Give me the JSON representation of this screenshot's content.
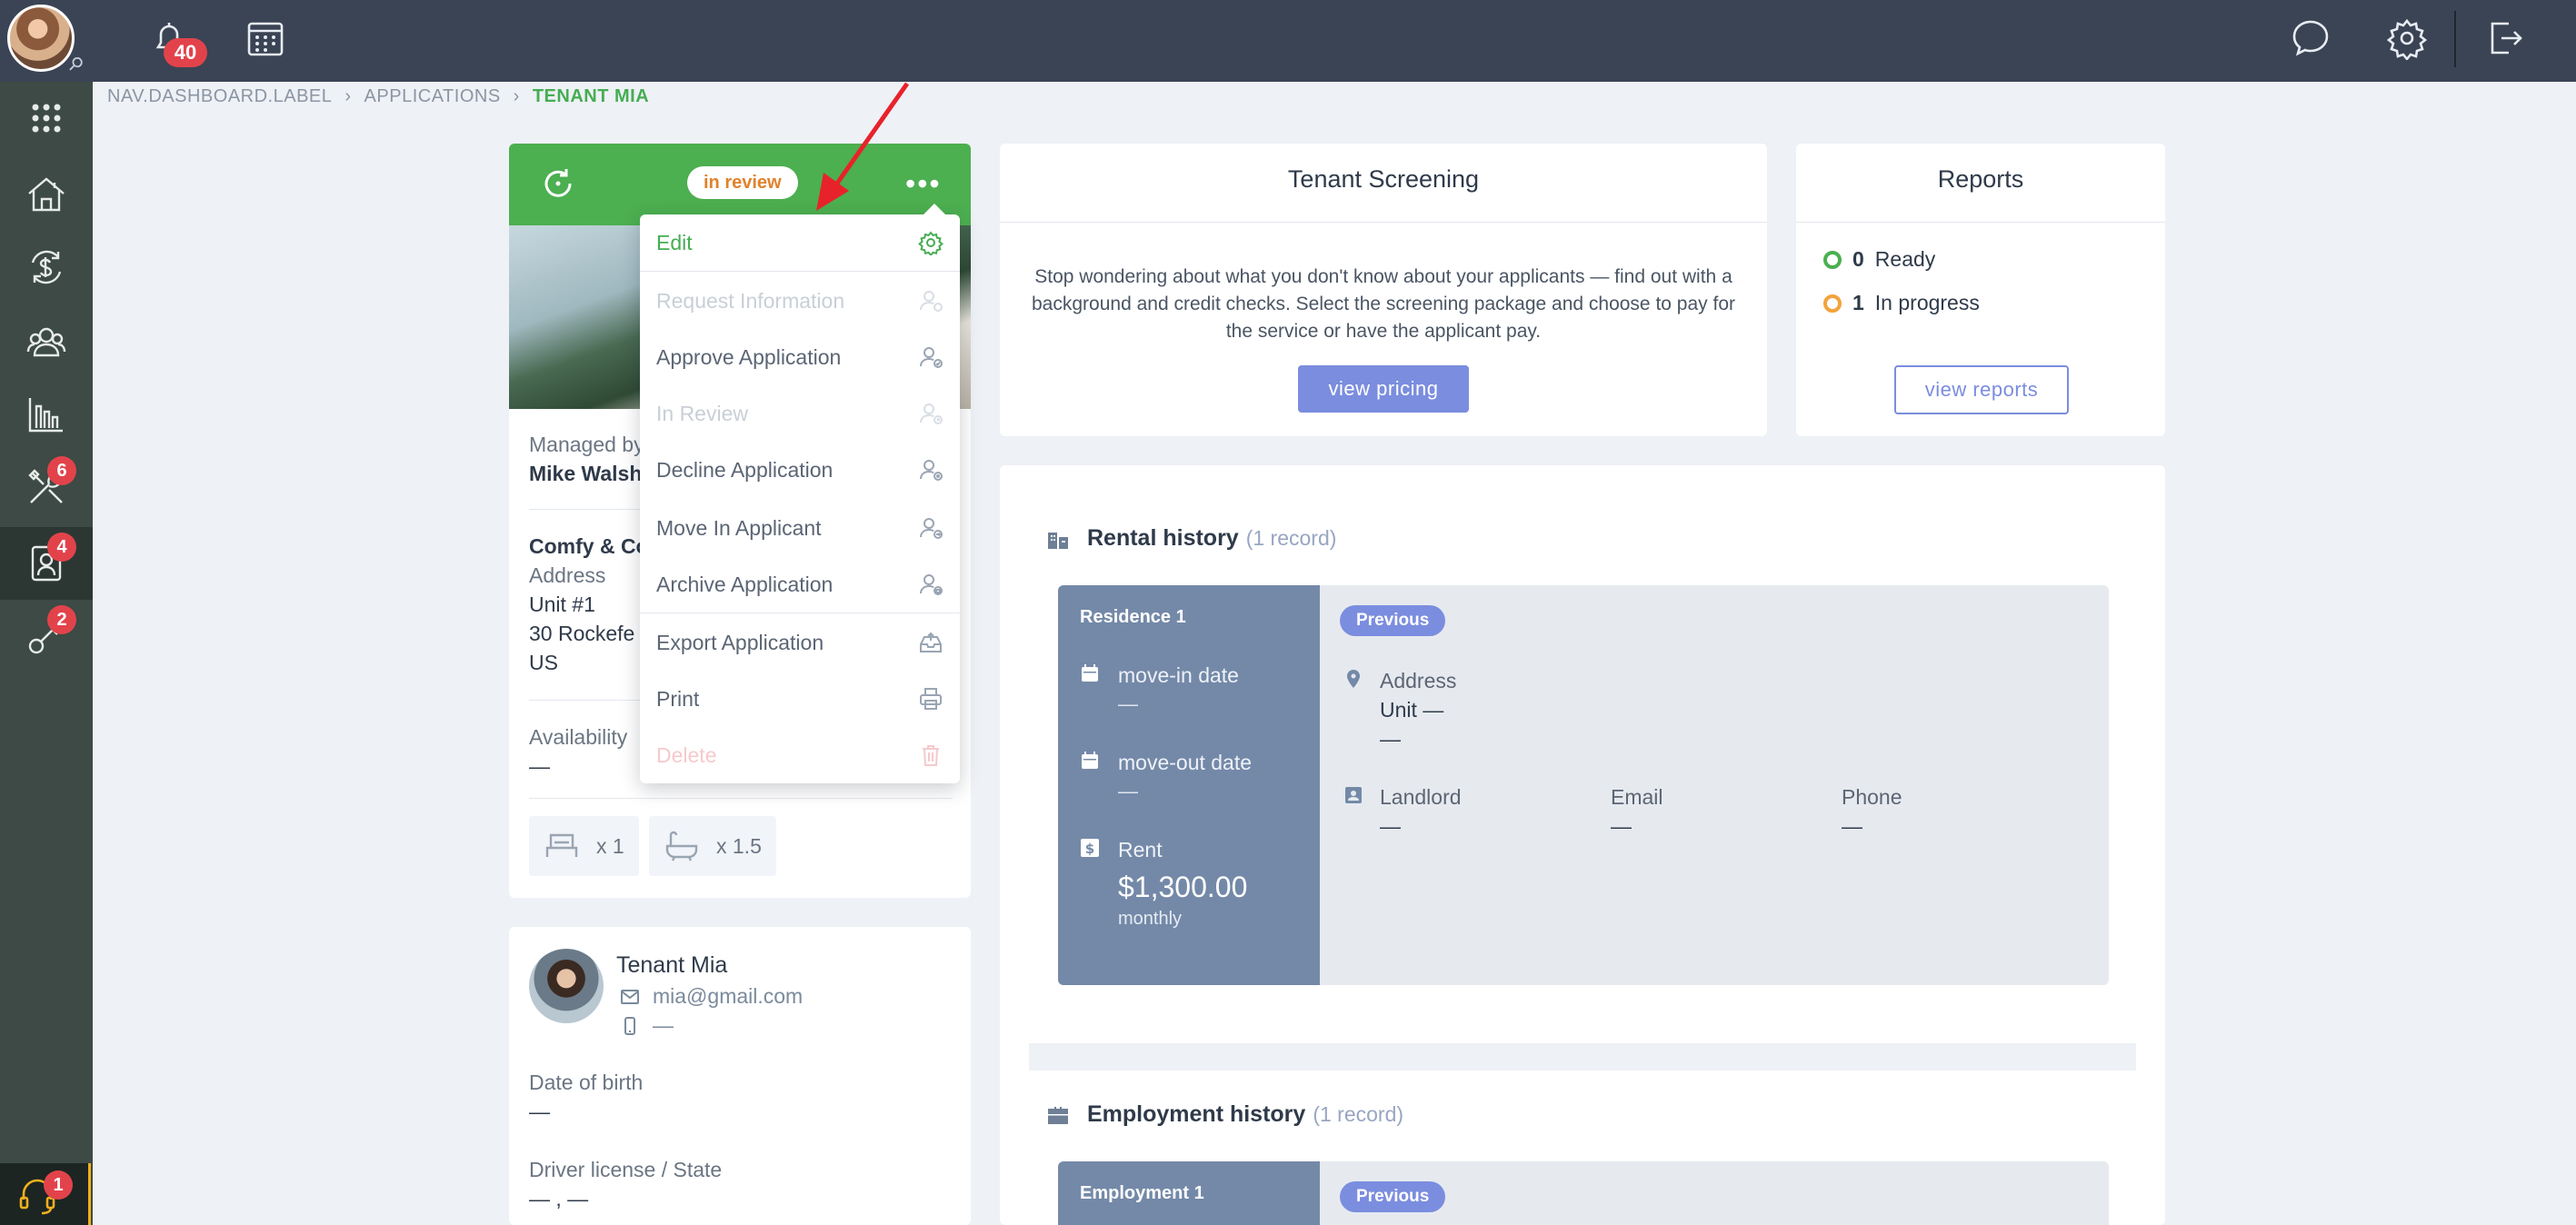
{
  "topbar": {
    "notification_count": "40"
  },
  "sidebar": {
    "items": [
      {
        "icon": "apps-grid-icon"
      },
      {
        "icon": "properties-icon"
      },
      {
        "icon": "accounting-icon"
      },
      {
        "icon": "people-icon"
      },
      {
        "icon": "reports-chart-icon"
      },
      {
        "icon": "maintenance-tools-icon",
        "badge": "6"
      },
      {
        "icon": "applications-icon",
        "badge": "4"
      },
      {
        "icon": "leases-icon",
        "badge": "2"
      }
    ],
    "help_badge": "1"
  },
  "breadcrumb": {
    "items": [
      "NAV.DASHBOARD.LABEL",
      "APPLICATIONS"
    ],
    "current": "TENANT MIA"
  },
  "property_card": {
    "status": "in review",
    "managed_by_label": "Managed by",
    "managed_by_name": "Mike Walsh",
    "property_name": "Comfy & Co",
    "address_label": "Address",
    "address_lines": [
      "Unit #1",
      "30 Rockefe",
      "US"
    ],
    "availability_label": "Availability",
    "availability_value": "—",
    "beds": "x 1",
    "baths": "x 1.5"
  },
  "menu": {
    "items": [
      {
        "label": "Edit",
        "state": "highlight",
        "icon": "gear-icon"
      },
      {
        "label": "Request Information",
        "state": "disabled",
        "icon": "user-info-icon"
      },
      {
        "label": "Approve Application",
        "state": "normal",
        "icon": "user-check-icon"
      },
      {
        "label": "In Review",
        "state": "disabled",
        "icon": "user-clock-icon"
      },
      {
        "label": "Decline Application",
        "state": "normal",
        "icon": "user-x-icon"
      },
      {
        "label": "Move In Applicant",
        "state": "normal",
        "icon": "user-move-icon"
      },
      {
        "label": "Archive Application",
        "state": "normal",
        "icon": "user-archive-icon"
      },
      {
        "label": "Export Application",
        "state": "normal",
        "icon": "export-tray-icon"
      },
      {
        "label": "Print",
        "state": "normal",
        "icon": "printer-icon"
      },
      {
        "label": "Delete",
        "state": "danger-disabled",
        "icon": "trash-icon"
      }
    ]
  },
  "tenant": {
    "name": "Tenant Mia",
    "email": "mia@gmail.com",
    "phone": "—",
    "dob_label": "Date of birth",
    "dob_value": "—",
    "license_label": "Driver license / State",
    "license_value": "— , —"
  },
  "screening": {
    "title": "Tenant Screening",
    "description": "Stop wondering about what you don't know about your applicants — find out with a background and credit checks. Select the screening package and choose to pay for the service or have the applicant pay.",
    "button": "view pricing"
  },
  "reports": {
    "title": "Reports",
    "ready_count": "0",
    "ready_label": "Ready",
    "progress_count": "1",
    "progress_label": "In progress",
    "button": "view reports",
    "colors": {
      "ready": "#4caf50",
      "progress": "#f2a33a"
    }
  },
  "rental_history": {
    "title": "Rental history",
    "count": "(1 record)",
    "residence_title": "Residence 1",
    "movein_label": "move-in date",
    "movein_value": "—",
    "moveout_label": "move-out date",
    "moveout_value": "—",
    "rent_label": "Rent",
    "rent_amount": "$1,300.00",
    "rent_period": "monthly",
    "tag": "Previous",
    "address_label": "Address",
    "address_line1": "Unit —",
    "address_line2": "—",
    "landlord_label": "Landlord",
    "landlord_value": "—",
    "email_label": "Email",
    "email_value": "—",
    "phone_label": "Phone",
    "phone_value": "—"
  },
  "employment_history": {
    "title": "Employment history",
    "count": "(1 record)",
    "employment_title": "Employment 1",
    "tag": "Previous"
  },
  "colors": {
    "brand_green": "#4caf50",
    "accent_blue": "#7b8ddf",
    "topbar": "#3a4454",
    "sidebar": "#3d4a45",
    "annotation_arrow": "#e8222a"
  }
}
